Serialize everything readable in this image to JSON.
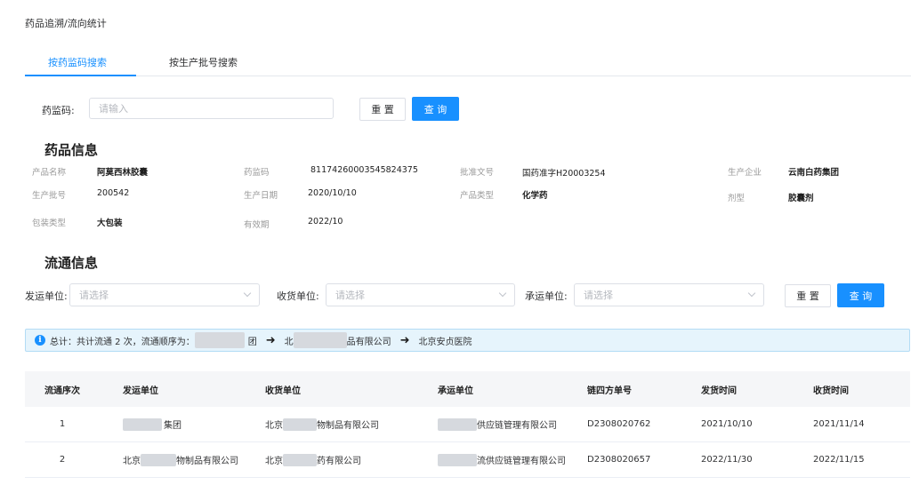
{
  "breadcrumb": "药品追溯/流向统计",
  "tabs": [
    {
      "label": "按药监码搜索",
      "active": true
    },
    {
      "label": "按生产批号搜索",
      "active": false
    }
  ],
  "search": {
    "label": "药监码:",
    "placeholder": "请输入",
    "reset_label": "重 置",
    "query_label": "查 询"
  },
  "drug_info": {
    "title": "药品信息",
    "fields": {
      "product_name": {
        "key": "产品名称",
        "value": "阿莫西林胶囊"
      },
      "code": {
        "key": "药监码",
        "value": "81174260003545824375"
      },
      "approval": {
        "key": "批准文号",
        "value": "国药准字H20003254"
      },
      "manufacturer": {
        "key": "生产企业",
        "value": "云南白药集团"
      },
      "batch": {
        "key": "生产批号",
        "value": "200542"
      },
      "prod_date": {
        "key": "生产日期",
        "value": "2020/10/10"
      },
      "type": {
        "key": "产品类型",
        "value": "化学药"
      },
      "form": {
        "key": "剂型",
        "value": "胶囊剂"
      },
      "package": {
        "key": "包装类型",
        "value": "大包装"
      },
      "expiry": {
        "key": "有效期",
        "value": "2022/10"
      }
    }
  },
  "circulation": {
    "title": "流通信息",
    "filters": {
      "sender_label": "发运单位:",
      "sender_placeholder": "请选择",
      "receiver_label": "收货单位:",
      "receiver_placeholder": "请选择",
      "carrier_label": "承运单位:",
      "carrier_placeholder": "请选择",
      "reset_label": "重 置",
      "query_label": "查 询"
    },
    "summary": {
      "prefix": "总计：共计流通 2 次，流通顺序为：",
      "node1_tail": "团",
      "node2_head": "北",
      "node2_tail": "品有限公司",
      "node3": "北京安贞医院"
    },
    "columns": [
      "流通序次",
      "发运单位",
      "收货单位",
      "承运单位",
      "链四方单号",
      "发货时间",
      "收货时间"
    ],
    "rows": [
      {
        "seq": "1",
        "sender": "集团",
        "receiver_head": "北京",
        "receiver": "物制品有限公司",
        "carrier": "供应链管理有限公司",
        "order": "D2308020762",
        "ship": "2021/10/10",
        "recv": "2021/11/14"
      },
      {
        "seq": "2",
        "sender_head": "北京",
        "sender": "物制品有限公司",
        "receiver_head": "北京",
        "receiver": "药有限公司",
        "carrier": "流供应链管理有限公司",
        "order": "D2308020657",
        "ship": "2022/11/30",
        "recv": "2022/11/15"
      }
    ]
  },
  "colors": {
    "primary": "#1890ff",
    "alert_bg": "#e6f4fc"
  },
  "icons": [
    "info-icon",
    "arrow-right-icon",
    "chevron-down-icon"
  ]
}
